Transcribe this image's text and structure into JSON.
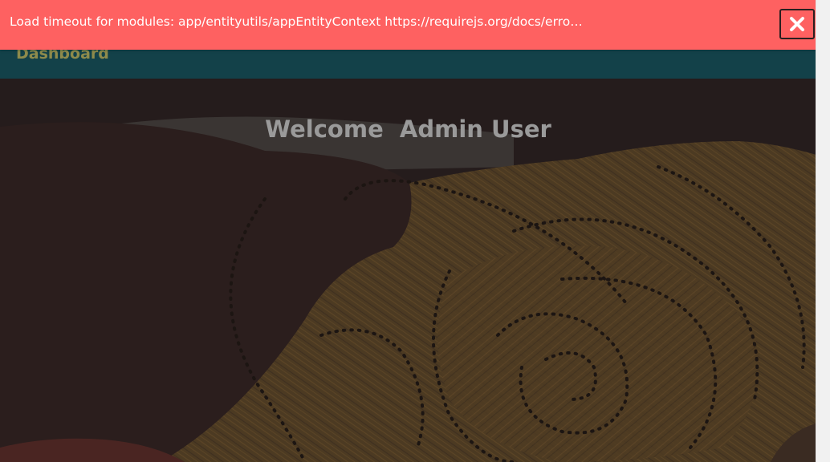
{
  "error_banner": {
    "message": "Load timeout for modules: app/entityutils/appEntityContext https://requirejs.org/docs/errors.html#timeout",
    "close_icon": "close-icon",
    "background": "#fe6161"
  },
  "header": {
    "title": "Dashboard",
    "background": "#134149",
    "title_color": "#8e8b4c"
  },
  "main": {
    "welcome_text": "Welcome  Admin User"
  }
}
